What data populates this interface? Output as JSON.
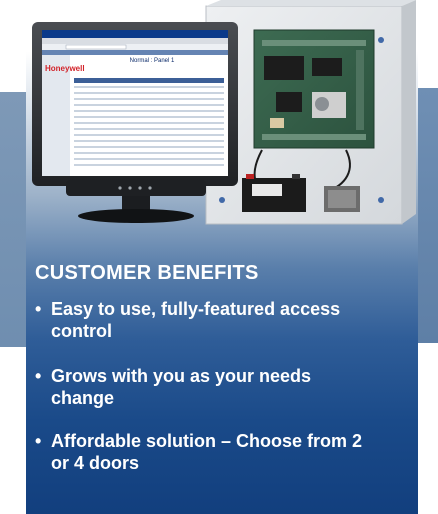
{
  "screen": {
    "logo": "Honeywell",
    "title": "Normal : Panel 1"
  },
  "benefits": {
    "title": "CUSTOMER BENEFITS",
    "items": [
      {
        "bullet": "•",
        "text": "Easy to use, fully-featured access control"
      },
      {
        "bullet": "•",
        "text": "Grows with you as your needs change"
      },
      {
        "bullet": "•",
        "text": "Affordable solution – Choose from 2 or 4 doors"
      }
    ]
  }
}
